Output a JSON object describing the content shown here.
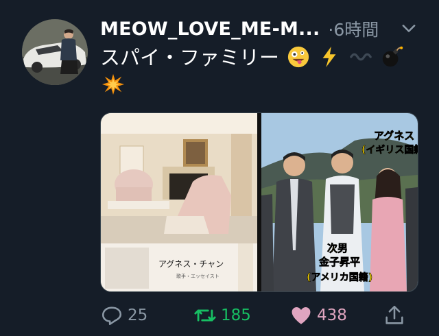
{
  "tweet": {
    "display_name": "MEOW_LOVE_ME-M...",
    "time": "·6時間",
    "text": "スパイ・ファミリー",
    "emojis": [
      "zany-face-icon",
      "lightning-icon",
      "wavy-dash-icon",
      "bomb-icon",
      "collision-icon"
    ]
  },
  "media": {
    "left_image": {
      "caption_title": "アグネス・チャン",
      "caption_sub": "歌手・エッセイスト"
    },
    "right_image": {
      "label_agnes_1": "アグネス",
      "label_agnes_2": "(イギリス国籍)",
      "label_son_1": "次男",
      "label_son_2": "金子昇平",
      "label_son_3": "(アメリカ国籍)"
    }
  },
  "actions": {
    "reply_count": "25",
    "retweet_count": "185",
    "like_count": "438"
  },
  "colors": {
    "background": "#151d28",
    "muted": "#8b98a5",
    "retweet": "#17bf63",
    "like": "#e0a5c0"
  }
}
